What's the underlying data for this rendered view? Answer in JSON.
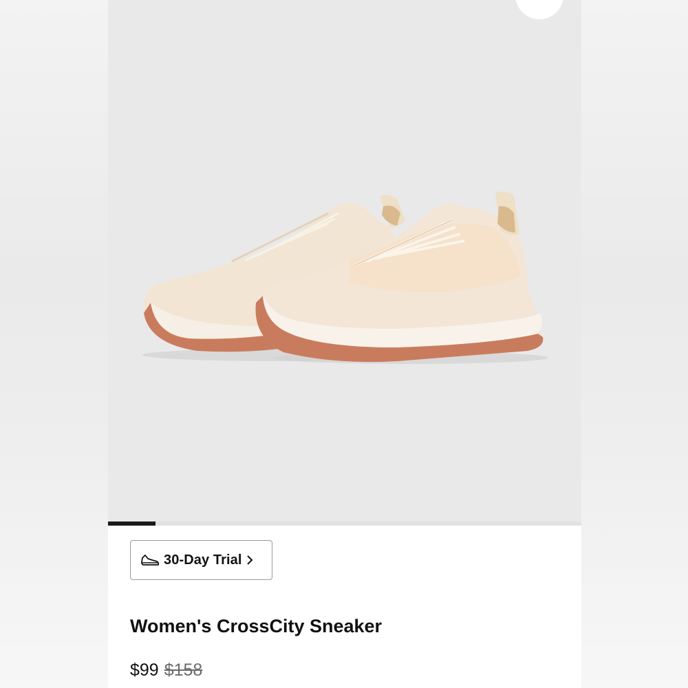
{
  "product": {
    "title": "Women's CrossCity Sneaker",
    "price": "$99",
    "original_price": "$158"
  },
  "trial": {
    "label": "30-Day Trial",
    "icon": "shoe-icon",
    "chevron": "chevron-right-icon"
  },
  "gallery": {
    "progress_fraction": 0.1,
    "image": "product-photo-sneaker-pair"
  },
  "colors": {
    "background": "#e9e9ea",
    "upper": "#f3e6d6",
    "sole": "#c97c5d",
    "text": "#111111",
    "strike": "#6b6b6b",
    "progress": "#1a1a1a"
  }
}
